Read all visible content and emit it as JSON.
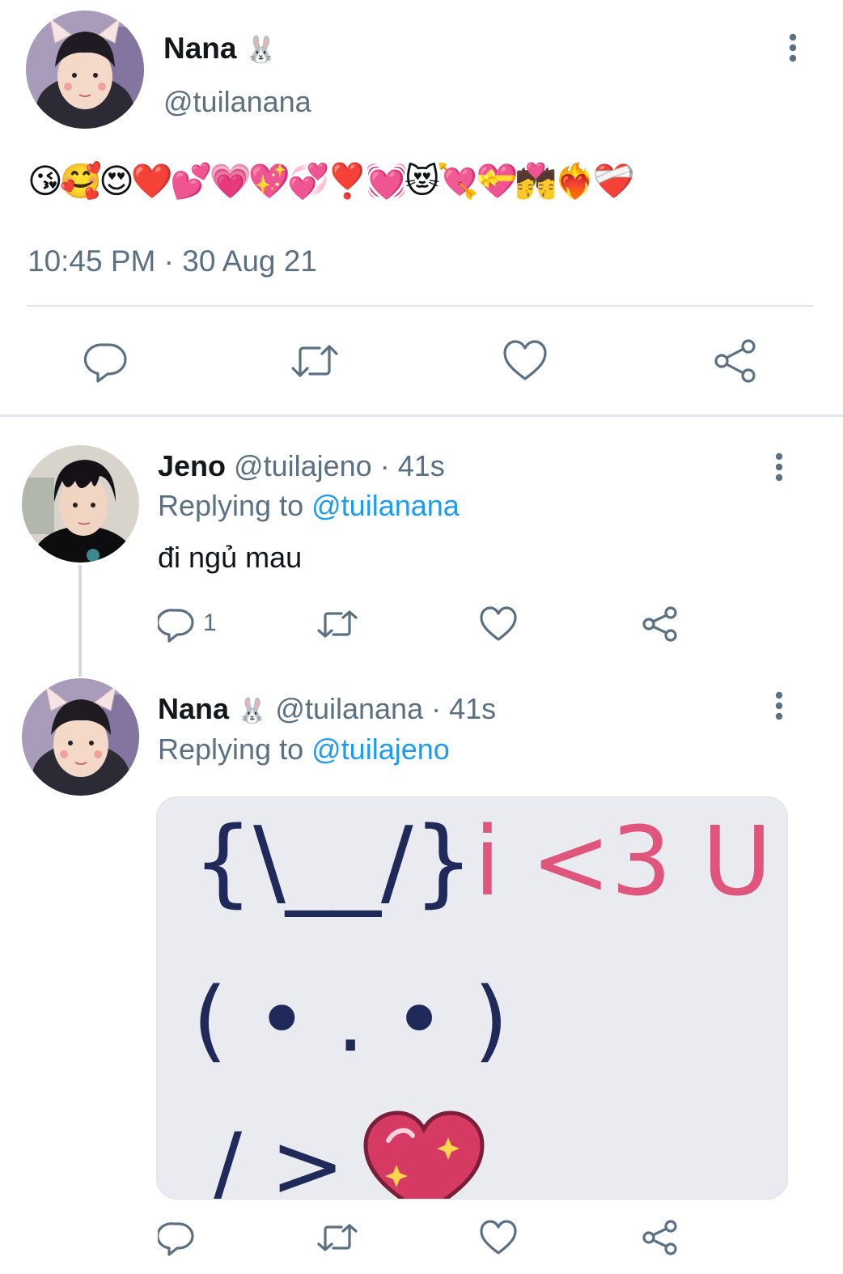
{
  "main_tweet": {
    "display_name": "Nana",
    "name_emoji": "🐰",
    "handle": "@tuilanana",
    "text": "😘🥰😍❤️💕💗💖💞❣️💓😻💘💝💏❤️‍🔥❤️‍🩹",
    "timestamp": "10:45 PM · 30 Aug 21",
    "actions": [
      {
        "icon": "reply-icon"
      },
      {
        "icon": "retweet-icon"
      },
      {
        "icon": "like-icon"
      },
      {
        "icon": "share-icon"
      }
    ]
  },
  "replies": [
    {
      "display_name": "Jeno",
      "handle": "@tuilajeno",
      "time": "· 41s",
      "replying_prefix": "Replying to",
      "replying_to": "@tuilanana",
      "text": "đi ngủ mau",
      "reply_count": "1"
    },
    {
      "display_name": "Nana",
      "name_emoji": "🐰",
      "handle": "@tuilanana",
      "time": "· 41s",
      "replying_prefix": "Replying to",
      "replying_to": "@tuilajeno",
      "media": {
        "line1_left": "{\\__/}",
        "line1_right": "i <3 U",
        "line2": "( • . • )",
        "line3": "/ >"
      }
    }
  ],
  "colors": {
    "link": "#1d9bf0",
    "secondary": "#5b7083",
    "divider": "#e1e8ed",
    "heart": "#d63a63",
    "media_pink": "#e0557b",
    "media_navy": "#1f2a5a"
  }
}
